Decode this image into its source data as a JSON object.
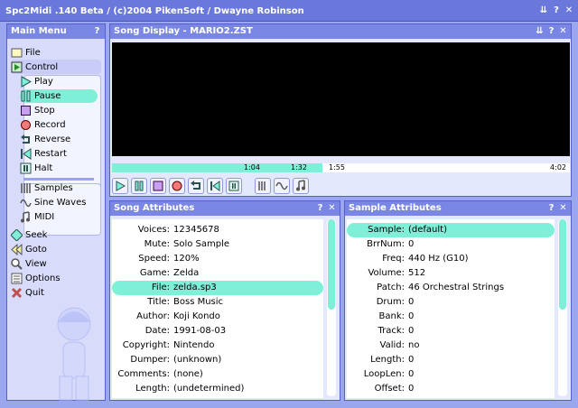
{
  "app": {
    "title": "Spc2Midi .140 Beta  /  (c)2004 PikenSoft  /  Dwayne Robinson",
    "window_buttons": [
      "⇊",
      "?",
      "✕"
    ]
  },
  "main_menu": {
    "title": "Main Menu",
    "help": "?",
    "file": "File",
    "control": "Control",
    "control_items": [
      "Play",
      "Pause",
      "Stop",
      "Record",
      "Reverse",
      "Restart",
      "Halt"
    ],
    "synth_items": [
      "Samples",
      "Sine Waves",
      "MIDI"
    ],
    "other_items": [
      "Seek",
      "Goto",
      "View",
      "Options",
      "Quit"
    ],
    "selected_control": "Pause"
  },
  "song_display": {
    "title": "Song Display - MARIO2.ZST",
    "buttons": [
      "⇊",
      "?",
      "✕"
    ],
    "time_marker1": "1:04",
    "time_marker2": "1:32",
    "time_marker3": "1:55",
    "time_total": "4:02",
    "progress_fraction": 0.46
  },
  "song_attributes": {
    "title": "Song Attributes",
    "buttons": [
      "?",
      "✕"
    ],
    "rows": [
      {
        "k": "Voices:",
        "v": "12345678"
      },
      {
        "k": "Mute:",
        "v": "Solo Sample"
      },
      {
        "k": "Speed:",
        "v": "120%"
      },
      {
        "k": "Game:",
        "v": "Zelda"
      },
      {
        "k": "File:",
        "v": "zelda.sp3"
      },
      {
        "k": "Title:",
        "v": "Boss Music"
      },
      {
        "k": "Author:",
        "v": "Koji Kondo"
      },
      {
        "k": "Date:",
        "v": "1991-08-03"
      },
      {
        "k": "Copyright:",
        "v": "Nintendo"
      },
      {
        "k": "Dumper:",
        "v": "(unknown)"
      },
      {
        "k": "Comments:",
        "v": "(none)"
      },
      {
        "k": "Length:",
        "v": "(undetermined)"
      }
    ],
    "highlighted": "File:"
  },
  "sample_attributes": {
    "title": "Sample Attributes",
    "buttons": [
      "?",
      "✕"
    ],
    "rows": [
      {
        "k": "Sample:",
        "v": "(default)"
      },
      {
        "k": "BrrNum:",
        "v": "0"
      },
      {
        "k": "Freq:",
        "v": "440 Hz (G10)"
      },
      {
        "k": "Volume:",
        "v": "512"
      },
      {
        "k": "Patch:",
        "v": "46 Orchestral Strings"
      },
      {
        "k": "Drum:",
        "v": "0"
      },
      {
        "k": "Bank:",
        "v": "0"
      },
      {
        "k": "Track:",
        "v": "0"
      },
      {
        "k": "Valid:",
        "v": "no"
      },
      {
        "k": "Length:",
        "v": "0"
      },
      {
        "k": "LoopLen:",
        "v": "0"
      },
      {
        "k": "Offset:",
        "v": "0"
      }
    ],
    "highlighted": "Sample:"
  },
  "colors": {
    "accent": "#7ef0d8",
    "title_bar": "#6a78dc",
    "panel_head": "#7a86e4",
    "background": "#9aa6ee"
  }
}
